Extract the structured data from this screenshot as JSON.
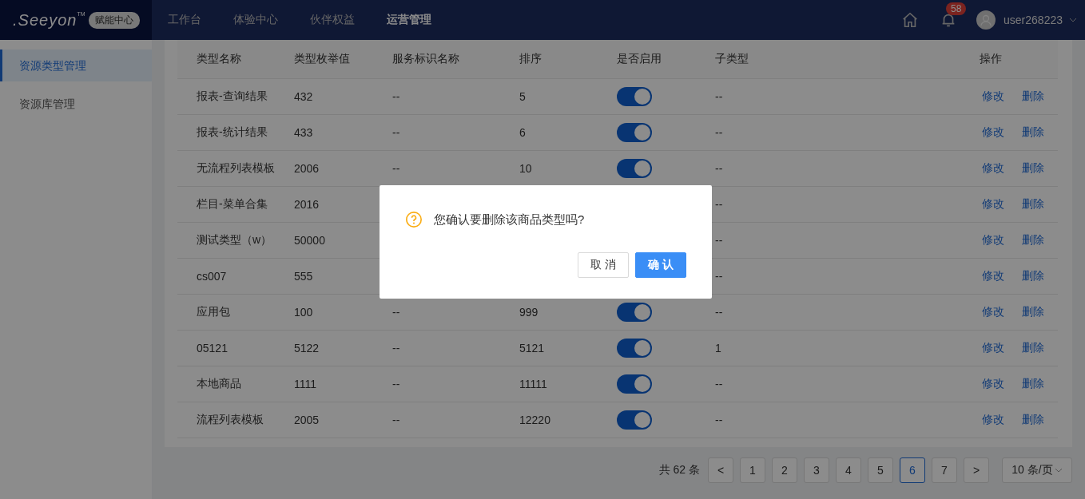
{
  "header": {
    "logo": ".Seeyon",
    "logo_tm": "TM",
    "badge": "赋能中心",
    "nav": [
      {
        "label": "工作台",
        "selected": false
      },
      {
        "label": "体验中心",
        "selected": false
      },
      {
        "label": "伙伴权益",
        "selected": false
      },
      {
        "label": "运营管理",
        "selected": true
      }
    ],
    "notification_count": "58",
    "username": "user268223"
  },
  "sidebar": {
    "items": [
      {
        "label": "资源类型管理",
        "selected": true
      },
      {
        "label": "资源库管理",
        "selected": false
      }
    ]
  },
  "table": {
    "columns": [
      "类型名称",
      "类型枚举值",
      "服务标识名称",
      "排序",
      "是否启用",
      "子类型",
      "操作"
    ],
    "rows": [
      {
        "name": "报表-查询结果",
        "value": "432",
        "service": "--",
        "order": "5",
        "enabled": true,
        "subtype": "--",
        "actions": [
          "修改",
          "删除"
        ]
      },
      {
        "name": "报表-统计结果",
        "value": "433",
        "service": "--",
        "order": "6",
        "enabled": true,
        "subtype": "--",
        "actions": [
          "修改",
          "删除"
        ]
      },
      {
        "name": "无流程列表模板",
        "value": "2006",
        "service": "--",
        "order": "10",
        "enabled": true,
        "subtype": "--",
        "actions": [
          "修改",
          "删除"
        ]
      },
      {
        "name": "栏目-菜单合集",
        "value": "2016",
        "subtype": "--",
        "actions": [
          "修改",
          "删除"
        ]
      },
      {
        "name": "测试类型（w）",
        "value": "50000",
        "subtype": "--",
        "actions": [
          "修改",
          "删除"
        ]
      },
      {
        "name": "cs007",
        "value": "555",
        "subtype": "--",
        "actions": [
          "修改",
          "删除"
        ]
      },
      {
        "name": "应用包",
        "value": "100",
        "service": "--",
        "order": "999",
        "enabled": true,
        "subtype": "--",
        "actions": [
          "修改",
          "删除"
        ]
      },
      {
        "name": "05121",
        "value": "5122",
        "service": "--",
        "order": "5121",
        "enabled": true,
        "subtype": "1",
        "actions": [
          "修改",
          "删除"
        ]
      },
      {
        "name": "本地商品",
        "value": "1111",
        "service": "--",
        "order": "11111",
        "enabled": true,
        "subtype": "--",
        "actions": [
          "修改",
          "删除"
        ]
      },
      {
        "name": "流程列表模板",
        "value": "2005",
        "service": "--",
        "order": "12220",
        "enabled": true,
        "subtype": "--",
        "actions": [
          "修改",
          "删除"
        ]
      }
    ]
  },
  "pagination": {
    "total": "共 62 条",
    "prev": "<",
    "pages": [
      {
        "label": "1",
        "selected": false
      },
      {
        "label": "2",
        "selected": false
      },
      {
        "label": "3",
        "selected": false
      },
      {
        "label": "4",
        "selected": false
      },
      {
        "label": "5",
        "selected": false
      },
      {
        "label": "6",
        "selected": true
      },
      {
        "label": "7",
        "selected": false
      }
    ],
    "next": ">",
    "page_size": "10 条/页"
  },
  "dialog": {
    "message": "您确认要删除该商品类型吗?",
    "buttons": [
      {
        "label": "取 消",
        "kind": "secondary"
      },
      {
        "label": "确 认",
        "kind": "primary"
      }
    ]
  }
}
